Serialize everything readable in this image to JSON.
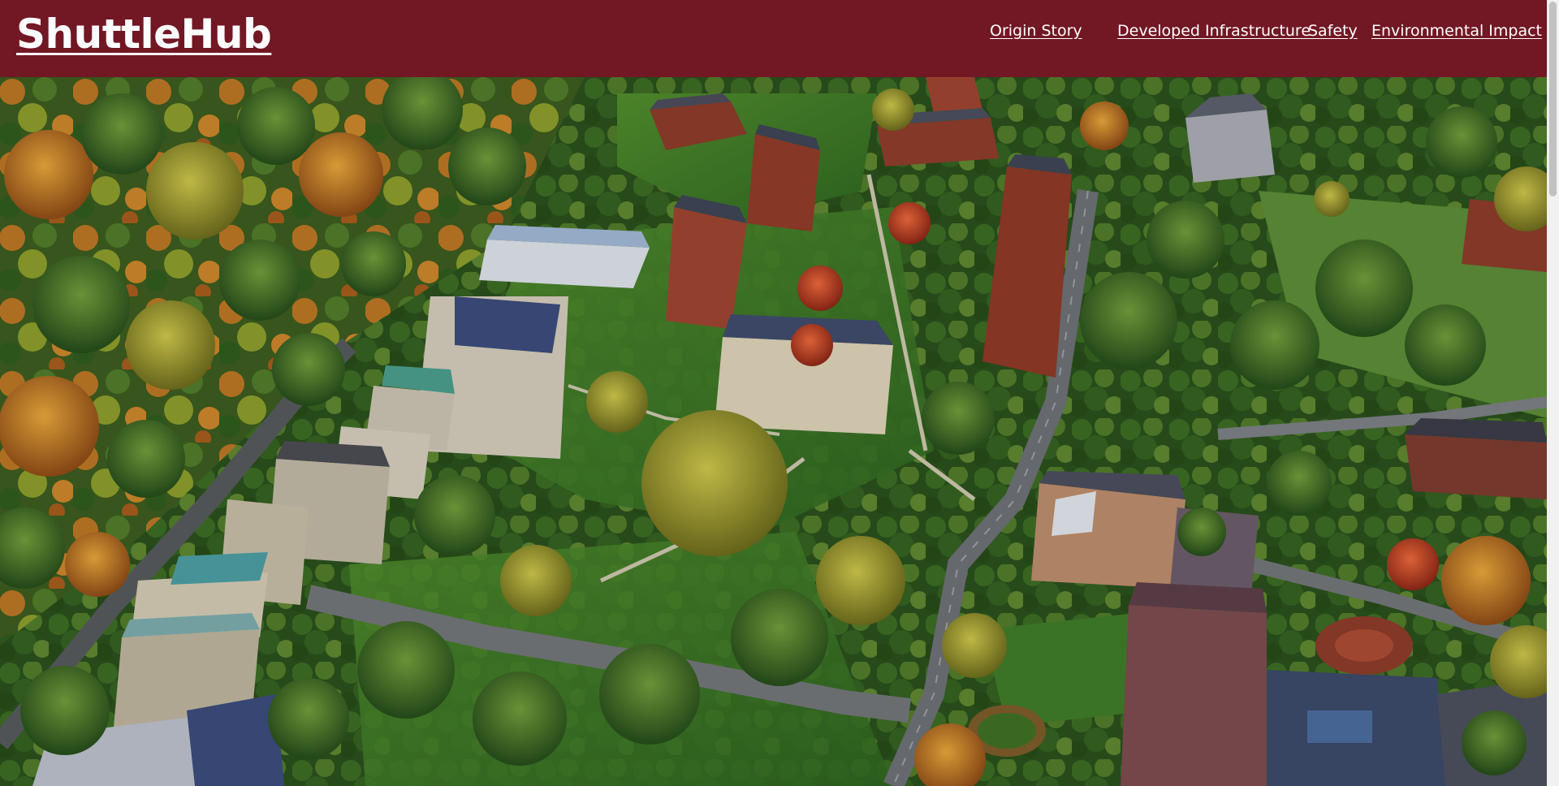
{
  "site": {
    "brand": "ShuttleHub"
  },
  "nav": {
    "items": [
      {
        "label": "Origin Story"
      },
      {
        "label": "Developed Infrastructure"
      },
      {
        "label": "Safety"
      },
      {
        "label": "Environmental Impact"
      }
    ]
  },
  "hero": {
    "image_subject": "aerial-campus-photo"
  },
  "colors": {
    "header_bg": "#721724",
    "nav_text": "#ffffff"
  }
}
